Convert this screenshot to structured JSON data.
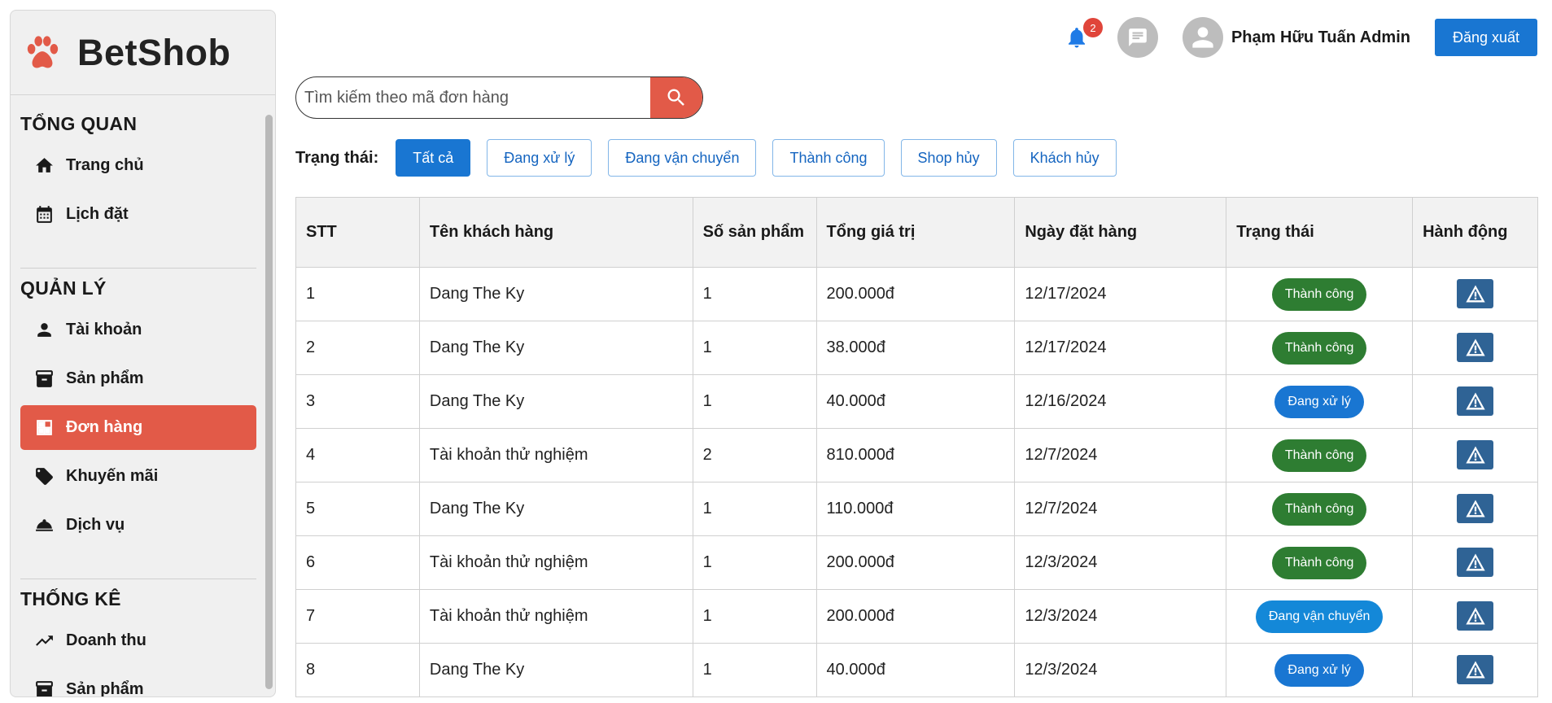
{
  "brand": {
    "name": "BetShob",
    "logo": "paw-icon"
  },
  "sidebar": {
    "sections": [
      {
        "title": "TỔNG QUAN",
        "items": [
          {
            "label": "Trang chủ",
            "icon": "home-icon"
          },
          {
            "label": "Lịch đặt",
            "icon": "calendar-icon"
          }
        ]
      },
      {
        "title": "QUẢN LÝ",
        "items": [
          {
            "label": "Tài khoản",
            "icon": "person-icon"
          },
          {
            "label": "Sản phẩm",
            "icon": "archive-icon"
          },
          {
            "label": "Đơn hàng",
            "icon": "dashboard-icon",
            "active": true
          },
          {
            "label": "Khuyến mãi",
            "icon": "tag-icon"
          },
          {
            "label": "Dịch vụ",
            "icon": "room-service-icon"
          }
        ]
      },
      {
        "title": "THỐNG KÊ",
        "items": [
          {
            "label": "Doanh thu",
            "icon": "trending-up-icon"
          },
          {
            "label": "Sản phẩm",
            "icon": "archive-icon"
          }
        ]
      }
    ]
  },
  "header": {
    "notification_count": "2",
    "user_name": "Phạm Hữu Tuấn Admin",
    "logout_label": "Đăng xuất"
  },
  "search": {
    "placeholder": "Tìm kiếm theo mã đơn hàng",
    "value": ""
  },
  "filters": {
    "title": "Trạng thái:",
    "options": [
      "Tất cả",
      "Đang xử lý",
      "Đang vận chuyển",
      "Thành công",
      "Shop hủy",
      "Khách hủy"
    ],
    "selected": "Tất cả"
  },
  "table": {
    "headers": [
      "STT",
      "Tên khách hàng",
      "Số sản phẩm",
      "Tổng giá trị",
      "Ngày đặt hàng",
      "Trạng thái",
      "Hành động"
    ],
    "rows": [
      {
        "stt": "1",
        "customer": "Dang The Ky",
        "qty": "1",
        "total": "200.000đ",
        "date": "12/17/2024",
        "status": "Thành công",
        "status_type": "ok"
      },
      {
        "stt": "2",
        "customer": "Dang The Ky",
        "qty": "1",
        "total": "38.000đ",
        "date": "12/17/2024",
        "status": "Thành công",
        "status_type": "ok"
      },
      {
        "stt": "3",
        "customer": "Dang The Ky",
        "qty": "1",
        "total": "40.000đ",
        "date": "12/16/2024",
        "status": "Đang xử lý",
        "status_type": "proc"
      },
      {
        "stt": "4",
        "customer": "Tài khoản thử nghiệm",
        "qty": "2",
        "total": "810.000đ",
        "date": "12/7/2024",
        "status": "Thành công",
        "status_type": "ok"
      },
      {
        "stt": "5",
        "customer": "Dang The Ky",
        "qty": "1",
        "total": "110.000đ",
        "date": "12/7/2024",
        "status": "Thành công",
        "status_type": "ok"
      },
      {
        "stt": "6",
        "customer": "Tài khoản thử nghiệm",
        "qty": "1",
        "total": "200.000đ",
        "date": "12/3/2024",
        "status": "Thành công",
        "status_type": "ok"
      },
      {
        "stt": "7",
        "customer": "Tài khoản thử nghiệm",
        "qty": "1",
        "total": "200.000đ",
        "date": "12/3/2024",
        "status": "Đang vận chuyển",
        "status_type": "ship"
      },
      {
        "stt": "8",
        "customer": "Dang The Ky",
        "qty": "1",
        "total": "40.000đ",
        "date": "12/3/2024",
        "status": "Đang xử lý",
        "status_type": "proc"
      }
    ]
  },
  "colors": {
    "accent": "#e25a48",
    "primary": "#1976d2",
    "success": "#2e7d32",
    "action": "#2f6395"
  }
}
